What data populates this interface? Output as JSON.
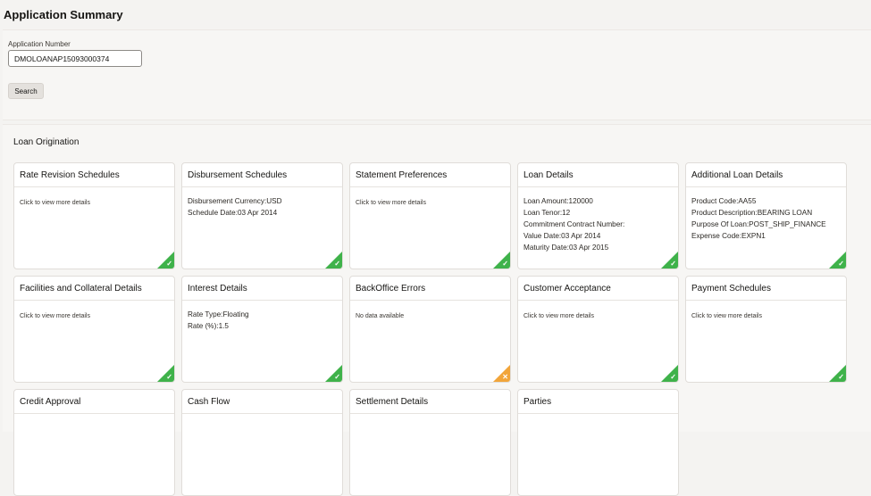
{
  "page": {
    "title": "Application Summary"
  },
  "search": {
    "label": "Application Number",
    "value": "DMOLOANAP15093000374",
    "button": "Search"
  },
  "section": {
    "title": "Loan Origination"
  },
  "colors": {
    "complete": "#3fb24a",
    "warning": "#f2a53a"
  },
  "cards": [
    {
      "title": "Rate Revision Schedules",
      "lines": [
        "Click to view more details"
      ],
      "status": "complete"
    },
    {
      "title": "Disbursement Schedules",
      "lines": [
        "Disbursement Currency:USD",
        "Schedule Date:03 Apr 2014"
      ],
      "status": "complete"
    },
    {
      "title": "Statement Preferences",
      "lines": [
        "Click to view more details"
      ],
      "status": "complete"
    },
    {
      "title": "Loan Details",
      "lines": [
        "Loan Amount:120000",
        "Loan Tenor:12",
        "Commitment Contract Number:",
        "Value Date:03 Apr 2014",
        "Maturity Date:03 Apr 2015"
      ],
      "status": "complete"
    },
    {
      "title": "Additional Loan Details",
      "lines": [
        "Product Code:AA55",
        "Product Description:BEARING LOAN",
        "Purpose Of Loan:POST_SHIP_FINANCE",
        "Expense Code:EXPN1"
      ],
      "status": "complete"
    },
    {
      "title": "Facilities and Collateral Details",
      "lines": [
        "Click to view more details"
      ],
      "status": "complete"
    },
    {
      "title": "Interest Details",
      "lines": [
        "Rate Type:Floating",
        "Rate (%):1.5"
      ],
      "status": "complete"
    },
    {
      "title": "BackOffice Errors",
      "lines": [
        "No data available"
      ],
      "status": "warning"
    },
    {
      "title": "Customer Acceptance",
      "lines": [
        "Click to view more details"
      ],
      "status": "complete"
    },
    {
      "title": "Payment Schedules",
      "lines": [
        "Click to view more details"
      ],
      "status": "complete"
    },
    {
      "title": "Credit Approval",
      "lines": [],
      "status": ""
    },
    {
      "title": "Cash Flow",
      "lines": [],
      "status": ""
    },
    {
      "title": "Settlement Details",
      "lines": [],
      "status": ""
    },
    {
      "title": "Parties",
      "lines": [],
      "status": ""
    }
  ]
}
